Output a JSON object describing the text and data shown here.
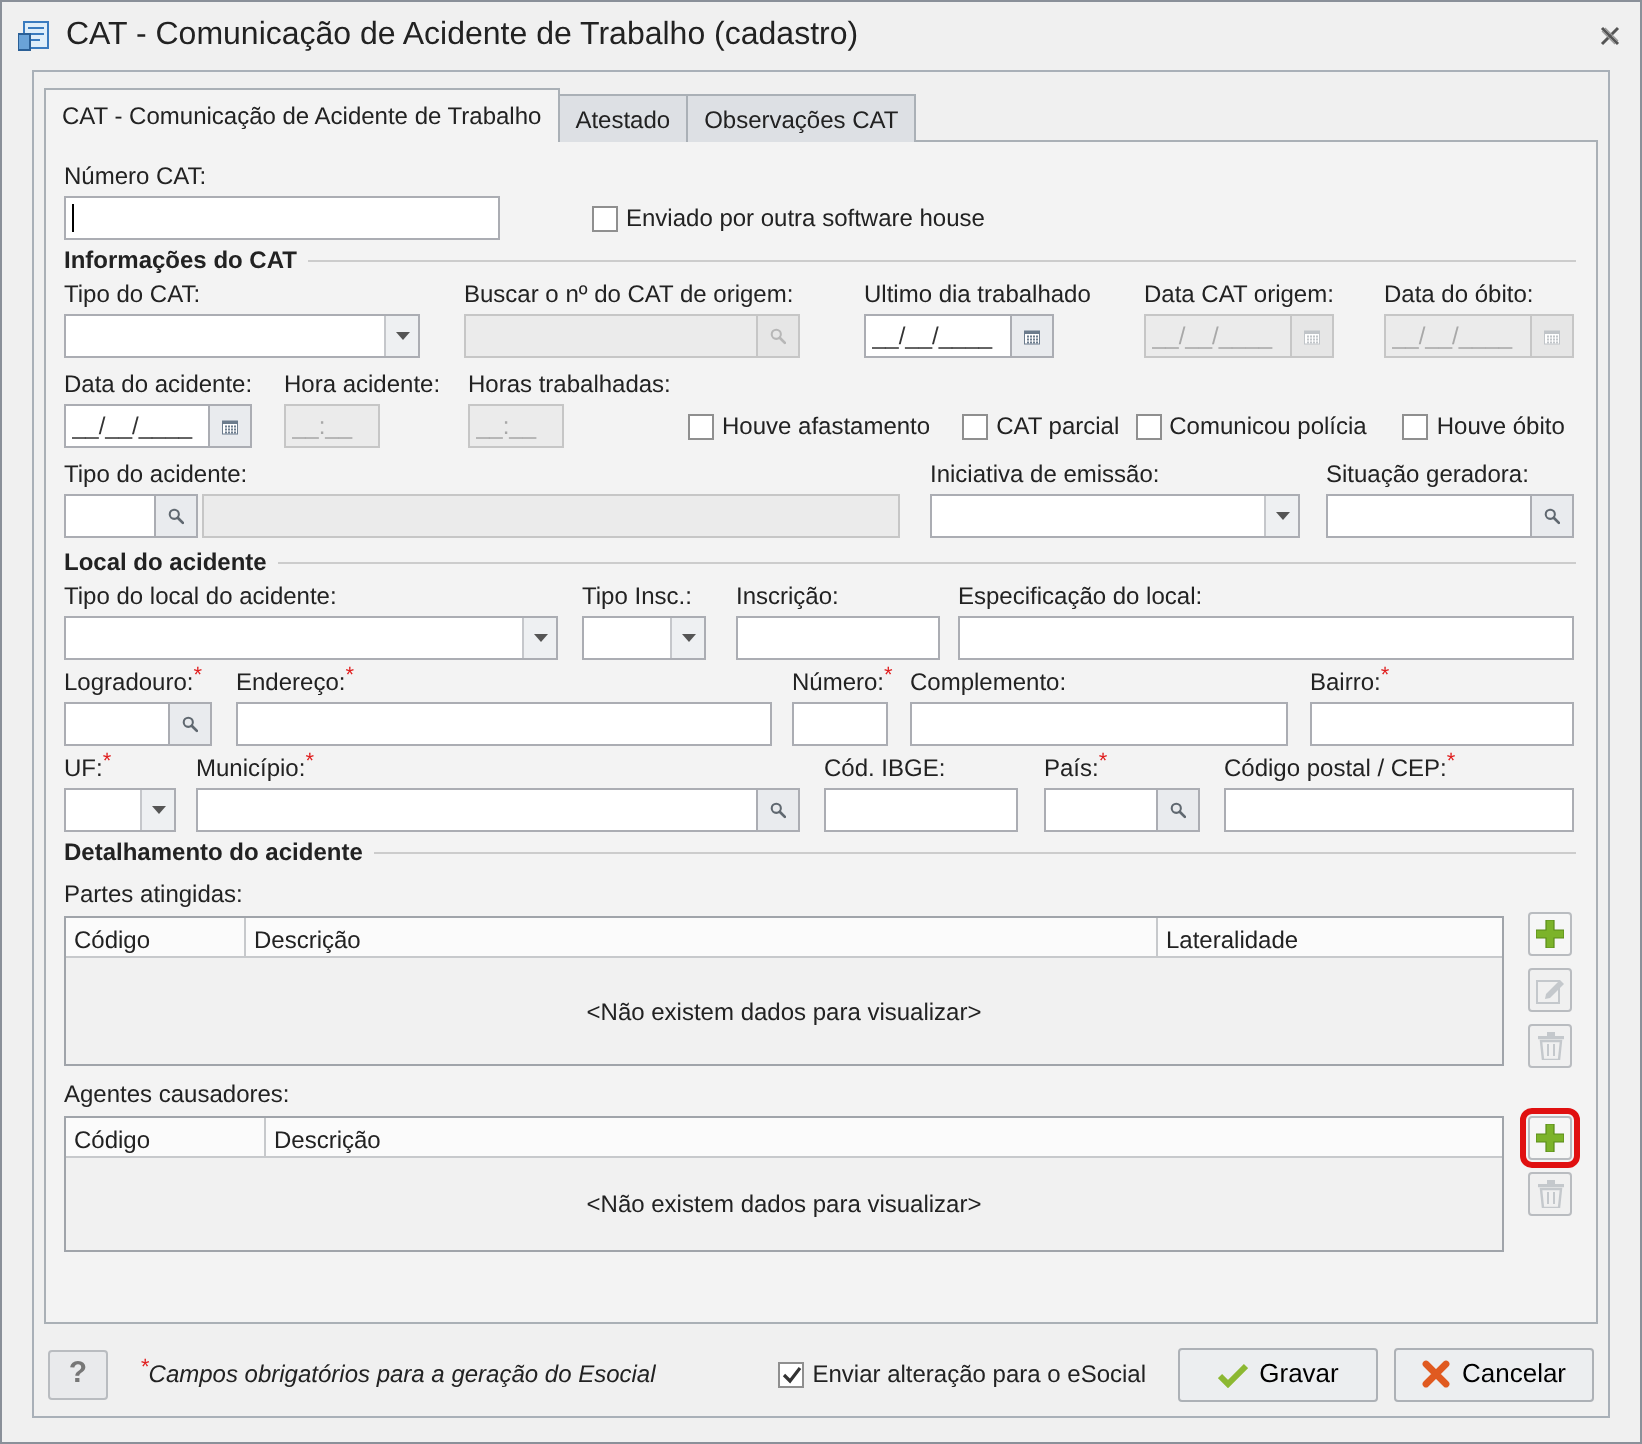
{
  "window": {
    "title": "CAT - Comunicação de Acidente de Trabalho (cadastro)"
  },
  "tabs": [
    {
      "label": "CAT - Comunicação de Acidente de Trabalho",
      "selected": true
    },
    {
      "label": "Atestado",
      "selected": false
    },
    {
      "label": "Observações CAT",
      "selected": false
    }
  ],
  "sections": [
    {
      "rows": [
        {
          "fields": [
            {
              "kind": "text",
              "label": "Número CAT:",
              "focused": true
            },
            {
              "kind": "checkbox",
              "label": "Enviado por outra software house",
              "checked": false
            }
          ]
        }
      ]
    },
    {
      "title": "Informações do CAT",
      "rows": [
        {
          "fields": [
            {
              "kind": "combo",
              "label": "Tipo do CAT:"
            },
            {
              "kind": "lookup",
              "label": "Buscar o nº do CAT de origem:",
              "disabled": true
            },
            {
              "kind": "date",
              "label": "Ultimo dia trabalhado",
              "placeholder": "__/__/____"
            },
            {
              "kind": "date",
              "label": "Data CAT origem:",
              "placeholder": "__/__/____",
              "disabled": true
            },
            {
              "kind": "date",
              "label": "Data do óbito:",
              "placeholder": "__/__/____",
              "disabled": true
            }
          ]
        },
        {
          "fields": [
            {
              "kind": "date",
              "label": "Data do acidente:",
              "placeholder": "__/__/____"
            },
            {
              "kind": "time",
              "label": "Hora acidente:",
              "placeholder": "__:__",
              "disabled": true
            },
            {
              "kind": "time",
              "label": "Horas trabalhadas:",
              "placeholder": "__:__",
              "disabled": true
            },
            {
              "kind": "checkbox",
              "label": "Houve afastamento",
              "checked": false
            },
            {
              "kind": "checkbox",
              "label": "CAT parcial",
              "checked": false
            },
            {
              "kind": "checkbox",
              "label": "Comunicou polícia",
              "checked": false
            },
            {
              "kind": "checkbox",
              "label": "Houve óbito",
              "checked": false
            }
          ]
        },
        {
          "fields": [
            {
              "kind": "lookup_desc",
              "label": "Tipo do acidente:"
            },
            {
              "kind": "combo",
              "label": "Iniciativa de emissão:"
            },
            {
              "kind": "lookup",
              "label": "Situação geradora:"
            }
          ]
        }
      ]
    },
    {
      "title": "Local do acidente",
      "rows": [
        {
          "fields": [
            {
              "kind": "combo",
              "label": "Tipo do local do acidente:"
            },
            {
              "kind": "combo",
              "label": "Tipo Insc.:"
            },
            {
              "kind": "text",
              "label": "Inscrição:"
            },
            {
              "kind": "text",
              "label": "Especificação do local:"
            }
          ]
        },
        {
          "fields": [
            {
              "kind": "lookup",
              "label": "Logradouro:$^{*}$"
            },
            {
              "kind": "text",
              "label": "Endereço:$^{*}$"
            },
            {
              "kind": "text",
              "label": "Número:$^{*}$"
            },
            {
              "kind": "text",
              "label": "Complemento:"
            },
            {
              "kind": "text",
              "label": "Bairro:$^{*}$"
            }
          ]
        },
        {
          "fields": [
            {
              "kind": "combo",
              "label": "UF:$^{*}$"
            },
            {
              "kind": "lookup",
              "label": "Município:$^{*}$"
            },
            {
              "kind": "text",
              "label": "Cód. IBGE:"
            },
            {
              "kind": "lookup",
              "label": "País:$^{*}$"
            },
            {
              "kind": "text",
              "label": "Código postal / CEP:$^{*}$"
            }
          ]
        }
      ]
    },
    {
      "title": "Detalhamento do acidente",
      "grids": [
        {
          "label": "Partes atingidas:",
          "columns": [
            "Código",
            "Descrição",
            "Lateralidade"
          ],
          "empty_text": "<Não existem dados para visualizar>",
          "buttons": [
            {
              "kind": "add",
              "disabled": false,
              "highlighted": false
            },
            {
              "kind": "edit",
              "disabled": true,
              "highlighted": false
            },
            {
              "kind": "delete",
              "disabled": true,
              "highlighted": false
            }
          ]
        },
        {
          "label": "Agentes causadores:",
          "columns": [
            "Código",
            "Descrição"
          ],
          "empty_text": "<Não existem dados para visualizar>",
          "buttons": [
            {
              "kind": "add",
              "disabled": false,
              "highlighted": true
            },
            {
              "kind": "delete",
              "disabled": true,
              "highlighted": false
            }
          ]
        }
      ]
    }
  ],
  "footer": {
    "help": "?",
    "note": "$^{*}$Campos obrigatórios para a geração do Esocial",
    "checkbox": {
      "label": "Enviar alteração para o eSocial",
      "checked": true
    },
    "buttons": [
      {
        "kind": "save",
        "label": "Gravar"
      },
      {
        "kind": "cancel",
        "label": "Cancelar"
      }
    ]
  }
}
